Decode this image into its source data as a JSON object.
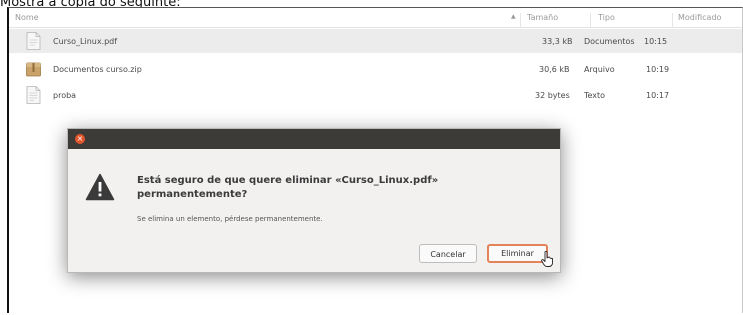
{
  "caption": "Mostra a copia do seguinte:",
  "file_list": {
    "columns": {
      "name": "Nome",
      "size": "Tamaño",
      "type": "Tipo",
      "modified": "Modificado"
    },
    "rows": [
      {
        "name": "Curso_Linux.pdf",
        "size": "33,3 kB",
        "type": "Documentos",
        "modified": "10:15",
        "icon": "pdf-document-icon"
      },
      {
        "name": "Documentos curso.zip",
        "size": "30,6 kB",
        "type": "Arquivo",
        "modified": "10:19",
        "icon": "zip-archive-icon"
      },
      {
        "name": "proba",
        "size": "32 bytes",
        "type": "Texto",
        "modified": "10:17",
        "icon": "text-file-icon"
      }
    ]
  },
  "dialog": {
    "heading": "Está seguro de que quere eliminar «Curso_Linux.pdf» permanentemente?",
    "message": "Se elimina un elemento, pérdese permanentemente.",
    "cancel_label": "Cancelar",
    "confirm_label": "Eliminar",
    "icon": "warning-icon"
  },
  "colors": {
    "dialog_titlebar": "#3c3b37",
    "close_button": "#e2542c",
    "confirm_focus_border": "#e4835a",
    "selected_row": "#ececec"
  }
}
